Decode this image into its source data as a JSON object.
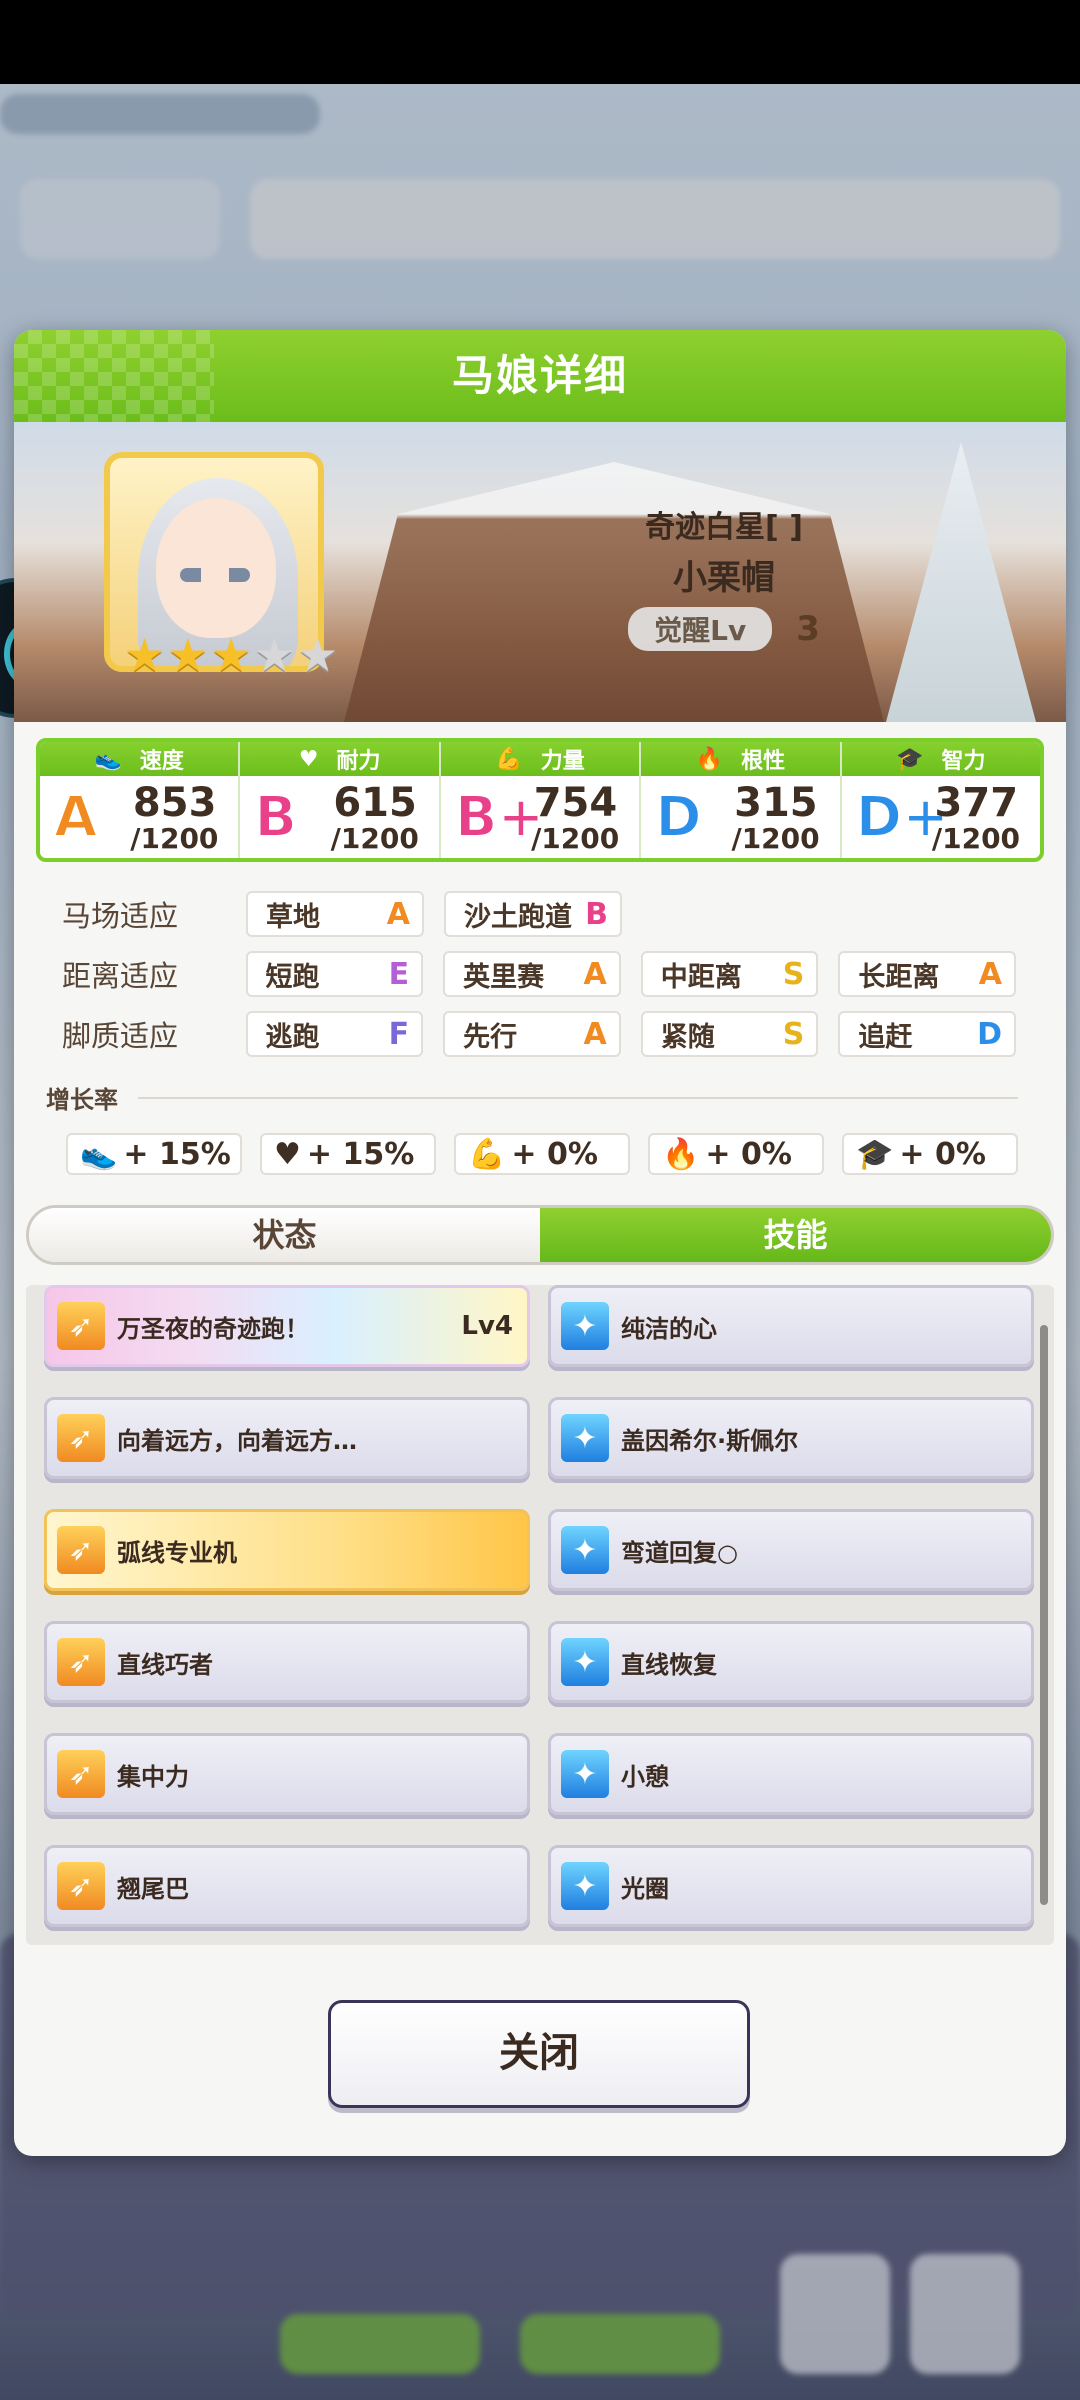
{
  "dialog": {
    "title": "马娘详细",
    "close_label": "关闭"
  },
  "character": {
    "outfit": "奇迹白星[ ]",
    "name": "小栗帽",
    "awaken_label": "觉醒Lv",
    "awaken_level": "3",
    "stars_filled": 3,
    "stars_total": 5
  },
  "stats": [
    {
      "label": "速度",
      "icon": "shoe-icon",
      "grade": "A",
      "value": "853",
      "max": "/1200",
      "color": "#f08a21"
    },
    {
      "label": "耐力",
      "icon": "heart-icon",
      "grade": "B",
      "value": "615",
      "max": "/1200",
      "color": "#e9408a"
    },
    {
      "label": "力量",
      "icon": "muscle-icon",
      "grade": "B+",
      "value": "754",
      "max": "/1200",
      "color": "#e9408a"
    },
    {
      "label": "根性",
      "icon": "flame-icon",
      "grade": "D",
      "value": "315",
      "max": "/1200",
      "color": "#2b8ee8"
    },
    {
      "label": "智力",
      "icon": "graduation-cap-icon",
      "grade": "D+",
      "value": "377",
      "max": "/1200",
      "color": "#2b8ee8"
    }
  ],
  "aptitude": {
    "track": {
      "label": "马场适应",
      "items": [
        {
          "name": "草地",
          "rank": "A"
        },
        {
          "name": "沙土跑道",
          "rank": "B"
        }
      ]
    },
    "distance": {
      "label": "距离适应",
      "items": [
        {
          "name": "短跑",
          "rank": "E"
        },
        {
          "name": "英里赛",
          "rank": "A"
        },
        {
          "name": "中距离",
          "rank": "S"
        },
        {
          "name": "长距离",
          "rank": "A"
        }
      ]
    },
    "style": {
      "label": "脚质适应",
      "items": [
        {
          "name": "逃跑",
          "rank": "F"
        },
        {
          "name": "先行",
          "rank": "A"
        },
        {
          "name": "紧随",
          "rank": "S"
        },
        {
          "name": "追赶",
          "rank": "D"
        }
      ]
    }
  },
  "growth": {
    "title": "增长率",
    "items": [
      "+ 15%",
      "+ 15%",
      "+ 0%",
      "+ 0%",
      "+ 0%"
    ]
  },
  "tabs": {
    "status": "状态",
    "skills": "技能"
  },
  "skills": [
    {
      "name": "万圣夜的奇迹跑！",
      "level": "Lv4",
      "icon": "orange",
      "style": "rainbow"
    },
    {
      "name": "纯洁的心",
      "level": "",
      "icon": "blue",
      "style": "normal"
    },
    {
      "name": "向着远方，向着远方…",
      "level": "",
      "icon": "orange",
      "style": "normal"
    },
    {
      "name": "盖因希尔·斯佩尔",
      "level": "",
      "icon": "blue",
      "style": "normal"
    },
    {
      "name": "弧线专业机",
      "level": "",
      "icon": "orange",
      "style": "gold"
    },
    {
      "name": "弯道回复○",
      "level": "",
      "icon": "blue",
      "style": "normal"
    },
    {
      "name": "直线巧者",
      "level": "",
      "icon": "orange",
      "style": "normal"
    },
    {
      "name": "直线恢复",
      "level": "",
      "icon": "blue",
      "style": "normal"
    },
    {
      "name": "集中力",
      "level": "",
      "icon": "orange",
      "style": "normal"
    },
    {
      "name": "小憩",
      "level": "",
      "icon": "blue",
      "style": "normal"
    },
    {
      "name": "翘尾巴",
      "level": "",
      "icon": "orange",
      "style": "normal"
    },
    {
      "name": "光圈",
      "level": "",
      "icon": "blue",
      "style": "normal"
    }
  ]
}
